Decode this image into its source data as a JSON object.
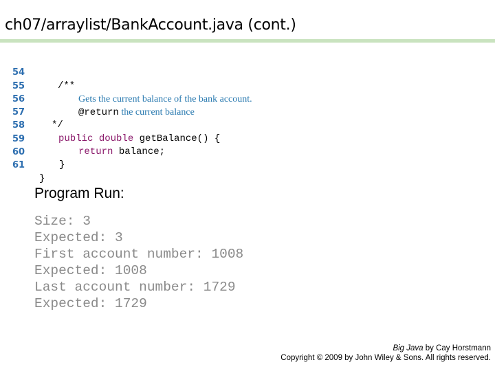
{
  "slide": {
    "title": "ch07/arraylist/BankAccount.java (cont.)",
    "accent_rule_color": "#c9e3bf"
  },
  "code": {
    "lines": [
      {
        "number": "54",
        "text": "/**"
      },
      {
        "number": "55",
        "text": "Gets the current balance of the bank account."
      },
      {
        "number": "56",
        "tag": "@return",
        "text": " the current balance"
      },
      {
        "number": "57",
        "text": "*/"
      },
      {
        "number": "58",
        "kw1": "public",
        "kw2": "double",
        "text": " getBalance() {"
      },
      {
        "number": "59",
        "kw1": "return",
        "text": " balance;"
      },
      {
        "number": "60",
        "text": "}"
      },
      {
        "number": "61",
        "text": "}"
      }
    ],
    "colors": {
      "line_number": "#2e6fb0",
      "keyword": "#8b1a6b",
      "javadoc": "#2a7ab0"
    }
  },
  "program_run": {
    "heading": "Program Run:",
    "output_lines": [
      "Size: 3",
      "Expected: 3",
      "First account number: 1008",
      "Expected: 1008",
      "Last account number: 1729",
      "Expected: 1729"
    ]
  },
  "footer": {
    "book_title": "Big Java",
    "author_text": " by Cay Horstmann",
    "copyright": "Copyright © 2009 by John Wiley & Sons.  All rights reserved."
  }
}
